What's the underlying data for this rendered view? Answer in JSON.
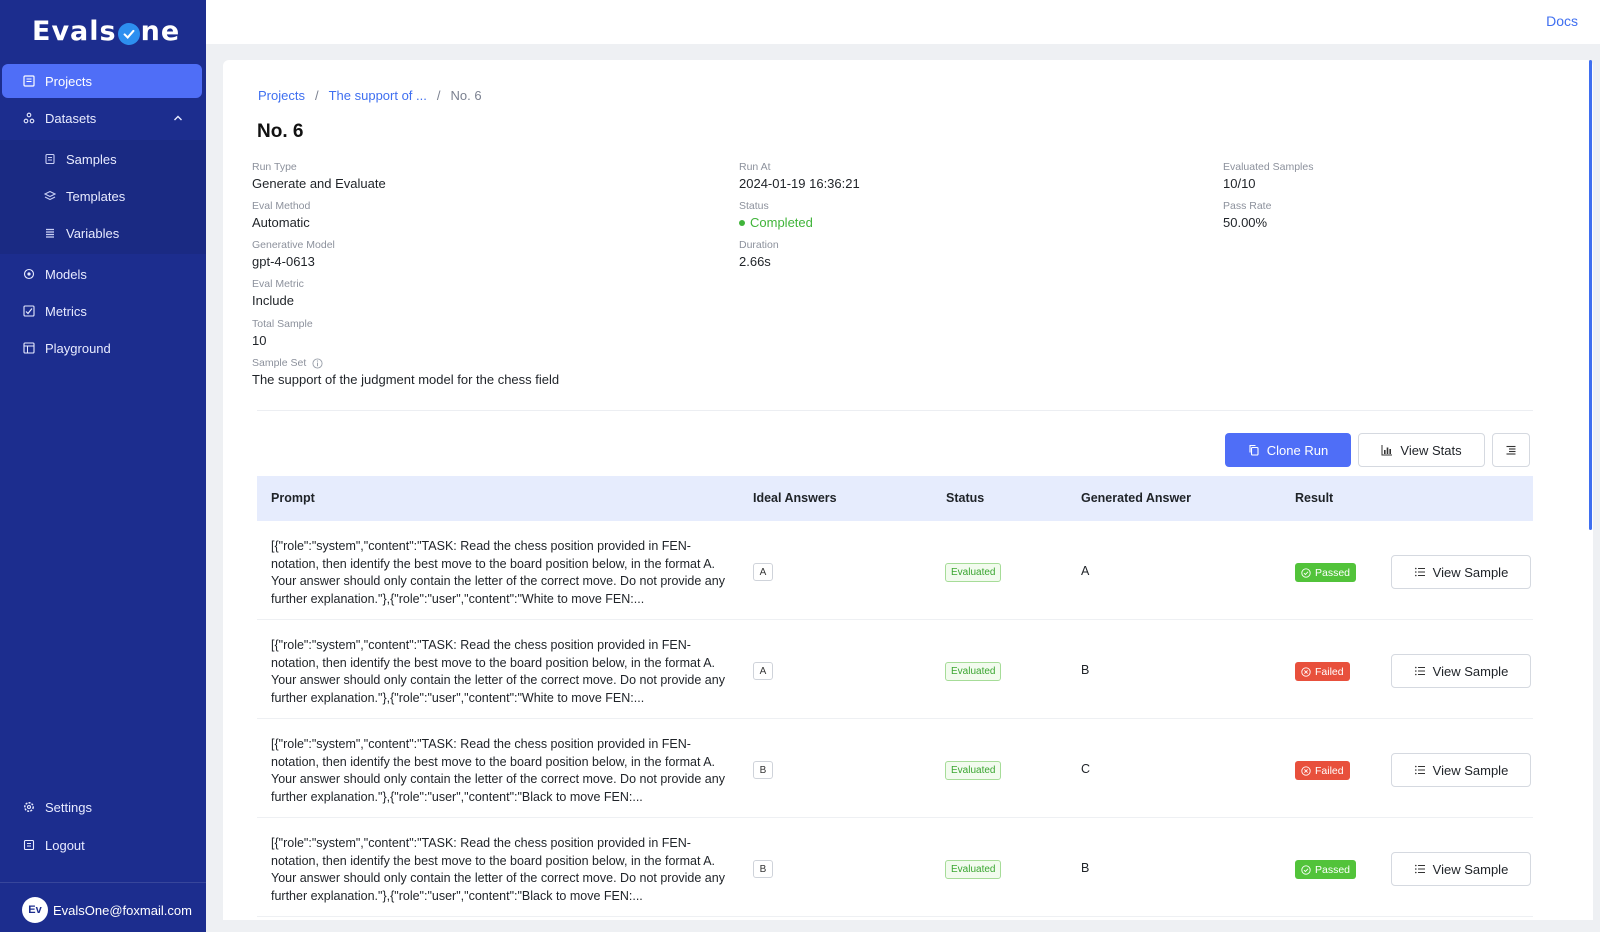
{
  "sidebar": {
    "logo_left": "Evals",
    "logo_right": "ne",
    "items": [
      {
        "label": "Projects"
      },
      {
        "label": "Datasets"
      },
      {
        "label": "Samples"
      },
      {
        "label": "Templates"
      },
      {
        "label": "Variables"
      },
      {
        "label": "Models"
      },
      {
        "label": "Metrics"
      },
      {
        "label": "Playground"
      },
      {
        "label": "Settings"
      },
      {
        "label": "Logout"
      }
    ],
    "user": {
      "initials": "Ev",
      "email": "EvalsOne@foxmail.com"
    }
  },
  "header": {
    "docs": "Docs"
  },
  "breadcrumb": {
    "root": "Projects",
    "project": "The support of ...",
    "current": "No. 6",
    "sep": "/"
  },
  "run": {
    "title": "No. 6",
    "fields": {
      "run_type": {
        "label": "Run Type",
        "value": "Generate and Evaluate"
      },
      "eval_method": {
        "label": "Eval Method",
        "value": "Automatic"
      },
      "generative_model": {
        "label": "Generative Model",
        "value": "gpt-4-0613"
      },
      "eval_metric": {
        "label": "Eval Metric",
        "value": "Include"
      },
      "total_sample": {
        "label": "Total Sample",
        "value": "10"
      },
      "sample_set": {
        "label": "Sample Set",
        "value": "The support of the judgment model for the chess field"
      },
      "run_at": {
        "label": "Run At",
        "value": "2024-01-19 16:36:21"
      },
      "status": {
        "label": "Status",
        "value": "Completed"
      },
      "duration": {
        "label": "Duration",
        "value": "2.66s"
      },
      "evaluated_samples": {
        "label": "Evaluated Samples",
        "value": "10/10"
      },
      "pass_rate": {
        "label": "Pass Rate",
        "value": "50.00%"
      }
    }
  },
  "actions": {
    "clone": "Clone Run",
    "stats": "View Stats"
  },
  "table": {
    "headers": [
      "Prompt",
      "Ideal Answers",
      "Status",
      "Generated Answer",
      "Result"
    ],
    "view_label": "View Sample",
    "rows": [
      {
        "prompt": "[{\"role\":\"system\",\"content\":\"TASK: Read the chess position provided in FEN-notation, then identify the best move to the board position below, in the format A. Your answer should only contain the letter of the correct move. Do not provide any further explanation.\"},{\"role\":\"user\",\"content\":\"White to move FEN:...",
        "ideal": "A",
        "status": "Evaluated",
        "generated": "A",
        "result": "Passed"
      },
      {
        "prompt": "[{\"role\":\"system\",\"content\":\"TASK: Read the chess position provided in FEN-notation, then identify the best move to the board position below, in the format A. Your answer should only contain the letter of the correct move. Do not provide any further explanation.\"},{\"role\":\"user\",\"content\":\"White to move FEN:...",
        "ideal": "A",
        "status": "Evaluated",
        "generated": "B",
        "result": "Failed"
      },
      {
        "prompt": "[{\"role\":\"system\",\"content\":\"TASK: Read the chess position provided in FEN-notation, then identify the best move to the board position below, in the format A. Your answer should only contain the letter of the correct move. Do not provide any further explanation.\"},{\"role\":\"user\",\"content\":\"Black to move FEN:...",
        "ideal": "B",
        "status": "Evaluated",
        "generated": "C",
        "result": "Failed"
      },
      {
        "prompt": "[{\"role\":\"system\",\"content\":\"TASK: Read the chess position provided in FEN-notation, then identify the best move to the board position below, in the format A. Your answer should only contain the letter of the correct move. Do not provide any further explanation.\"},{\"role\":\"user\",\"content\":\"Black to move FEN:...",
        "ideal": "B",
        "status": "Evaluated",
        "generated": "B",
        "result": "Passed"
      }
    ]
  },
  "colors": {
    "sidebar": "#1c2d8e",
    "accent": "#4f6ef7",
    "pass": "#52c33a",
    "fail": "#e8503c",
    "status_ok": "#40b43a"
  }
}
